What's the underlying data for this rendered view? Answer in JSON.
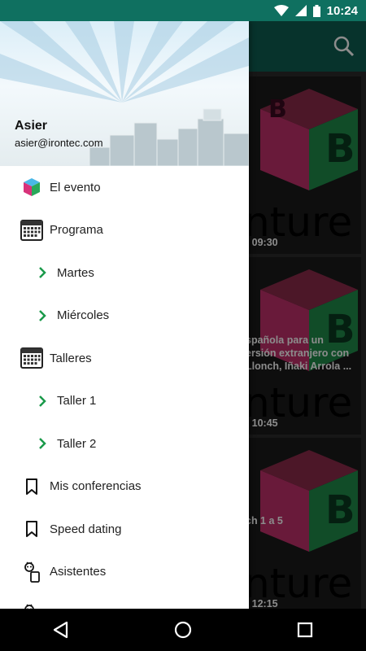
{
  "status_bar": {
    "time": "10:24"
  },
  "drawer": {
    "user_name": "Asier",
    "user_email": "asier@irontec.com",
    "items": [
      {
        "label": "El evento",
        "icon": "cube-logo-icon",
        "sub": false
      },
      {
        "label": "Programa",
        "icon": "calendar-icon",
        "sub": false
      },
      {
        "label": "Martes",
        "icon": "chevron-right-icon",
        "sub": true
      },
      {
        "label": "Miércoles",
        "icon": "chevron-right-icon",
        "sub": true
      },
      {
        "label": "Talleres",
        "icon": "calendar-icon",
        "sub": false
      },
      {
        "label": "Taller 1",
        "icon": "chevron-right-icon",
        "sub": true
      },
      {
        "label": "Taller 2",
        "icon": "chevron-right-icon",
        "sub": true
      },
      {
        "label": "Mis conferencias",
        "icon": "bookmark-icon",
        "sub": false
      },
      {
        "label": "Speed dating",
        "icon": "bookmark-icon",
        "sub": false
      },
      {
        "label": "Asistentes",
        "icon": "attendees-icon",
        "sub": false
      }
    ]
  },
  "cards": [
    {
      "lines": [
        "- 09:30"
      ],
      "venture": "nture"
    },
    {
      "lines": [
        "spañola para un",
        "ersión extranjero con",
        "Llonch, Iñaki Arrola ...",
        "- 10:45"
      ],
      "venture": "nture"
    },
    {
      "lines": [
        "ch 1 a 5",
        "- 12:15"
      ],
      "venture": "nture"
    }
  ],
  "colors": {
    "status_bar": "#0f7060",
    "app_bar": "#0d5e50",
    "chevron": "#1a9a4a"
  }
}
